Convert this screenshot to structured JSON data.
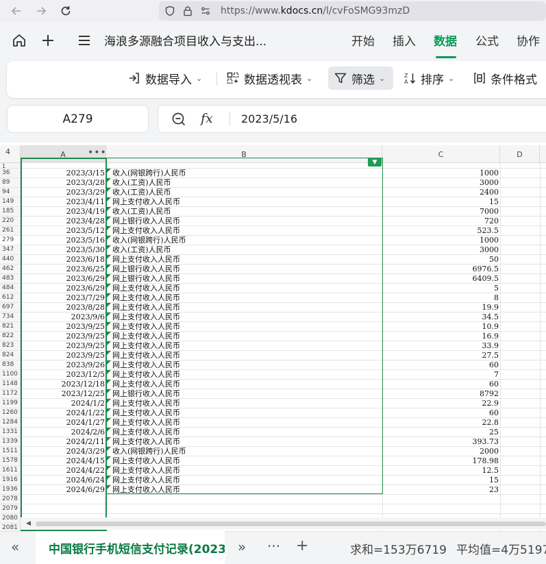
{
  "browser": {
    "url_prefix": "https://www.",
    "url_domain": "kdocs.cn",
    "url_path": "/l/cvFoSMG93mzD"
  },
  "header": {
    "doc_title": "海浪多源融合项目收入与支出...",
    "tabs": [
      "开始",
      "插入",
      "数据",
      "公式",
      "协作"
    ],
    "active_tab": "数据"
  },
  "ribbon": {
    "import_label": "数据导入",
    "pivot_label": "数据透视表",
    "filter_label": "筛选",
    "sort_label": "排序",
    "cond_format_label": "条件格式"
  },
  "formula_bar": {
    "cell_ref": "A279",
    "fx_label": "fx",
    "value": "2023/5/16"
  },
  "grid": {
    "columns": [
      "A",
      "B",
      "C",
      "D"
    ],
    "corner": "4",
    "header_row": "1",
    "rows": [
      {
        "num": "36",
        "date": "2023/3/15",
        "desc": "收入(网银跨行)人民币",
        "amount": "1000"
      },
      {
        "num": "89",
        "date": "2023/3/28",
        "desc": "收入(工资)人民币",
        "amount": "3000"
      },
      {
        "num": "94",
        "date": "2023/3/29",
        "desc": "收入(工资)人民币",
        "amount": "2400"
      },
      {
        "num": "149",
        "date": "2023/4/11",
        "desc": "网上支付收入人民币",
        "amount": "15"
      },
      {
        "num": "185",
        "date": "2023/4/19",
        "desc": "收入(工资)人民币",
        "amount": "7000"
      },
      {
        "num": "220",
        "date": "2023/4/28",
        "desc": "网上银行收入人民币",
        "amount": "720"
      },
      {
        "num": "261",
        "date": "2023/5/12",
        "desc": "网上支付收入人民币",
        "amount": "523.5"
      },
      {
        "num": "279",
        "date": "2023/5/16",
        "desc": "收入(网银跨行)人民币",
        "amount": "1000"
      },
      {
        "num": "347",
        "date": "2023/5/30",
        "desc": "收入(工资)人民币",
        "amount": "3000"
      },
      {
        "num": "440",
        "date": "2023/6/18",
        "desc": "网上支付收入人民币",
        "amount": "50"
      },
      {
        "num": "462",
        "date": "2023/6/25",
        "desc": "网上银行收入人民币",
        "amount": "6976.5"
      },
      {
        "num": "483",
        "date": "2023/6/29",
        "desc": "网上银行收入人民币",
        "amount": "6409.5"
      },
      {
        "num": "484",
        "date": "2023/6/29",
        "desc": "网上支付收入人民币",
        "amount": "5"
      },
      {
        "num": "612",
        "date": "2023/7/29",
        "desc": "网上支付收入人民币",
        "amount": "8"
      },
      {
        "num": "697",
        "date": "2023/8/28",
        "desc": "网上支付收入人民币",
        "amount": "19.9"
      },
      {
        "num": "734",
        "date": "2023/9/6",
        "desc": "网上支付收入人民币",
        "amount": "34.5"
      },
      {
        "num": "821",
        "date": "2023/9/25",
        "desc": "网上支付收入人民币",
        "amount": "10.9"
      },
      {
        "num": "822",
        "date": "2023/9/25",
        "desc": "网上支付收入人民币",
        "amount": "16.9"
      },
      {
        "num": "823",
        "date": "2023/9/25",
        "desc": "网上支付收入人民币",
        "amount": "33.9"
      },
      {
        "num": "824",
        "date": "2023/9/25",
        "desc": "网上支付收入人民币",
        "amount": "27.5"
      },
      {
        "num": "838",
        "date": "2023/9/26",
        "desc": "网上支付收入人民币",
        "amount": "60"
      },
      {
        "num": "1100",
        "date": "2023/12/5",
        "desc": "网上支付收入人民币",
        "amount": "7"
      },
      {
        "num": "1148",
        "date": "2023/12/18",
        "desc": "网上支付收入人民币",
        "amount": "60"
      },
      {
        "num": "1172",
        "date": "2023/12/25",
        "desc": "网上银行收入人民币",
        "amount": "8792"
      },
      {
        "num": "1199",
        "date": "2024/1/2",
        "desc": "网上支付收入人民币",
        "amount": "22.9"
      },
      {
        "num": "1260",
        "date": "2024/1/22",
        "desc": "网上支付收入人民币",
        "amount": "60"
      },
      {
        "num": "1284",
        "date": "2024/1/27",
        "desc": "网上支付收入人民币",
        "amount": "22.8"
      },
      {
        "num": "1331",
        "date": "2024/2/6",
        "desc": "网上支付收入人民币",
        "amount": "25"
      },
      {
        "num": "1339",
        "date": "2024/2/11",
        "desc": "网上支付收入人民币",
        "amount": "393.73"
      },
      {
        "num": "1511",
        "date": "2024/3/29",
        "desc": "收入(网银跨行)人民币",
        "amount": "2000"
      },
      {
        "num": "1578",
        "date": "2024/4/15",
        "desc": "网上支付收入人民币",
        "amount": "178.98"
      },
      {
        "num": "1611",
        "date": "2024/4/22",
        "desc": "网上支付收入人民币",
        "amount": "12.5"
      },
      {
        "num": "1916",
        "date": "2024/6/24",
        "desc": "网上支付收入人民币",
        "amount": "15"
      },
      {
        "num": "1936",
        "date": "2024/6/29",
        "desc": "网上支付收入人民币",
        "amount": "23"
      }
    ],
    "empty_rows": [
      "2078",
      "2079",
      "2080",
      "2081"
    ],
    "current_row": "279"
  },
  "bottom": {
    "sheet_name": "中国银行手机短信支付记录(2023",
    "sum_label": "求和=153万6719",
    "avg_label": "平均值=4万5197"
  },
  "colors": {
    "accent": "#0a9a55",
    "selection": "#1f8a4c",
    "cell_marker": "#1a8a3c"
  }
}
